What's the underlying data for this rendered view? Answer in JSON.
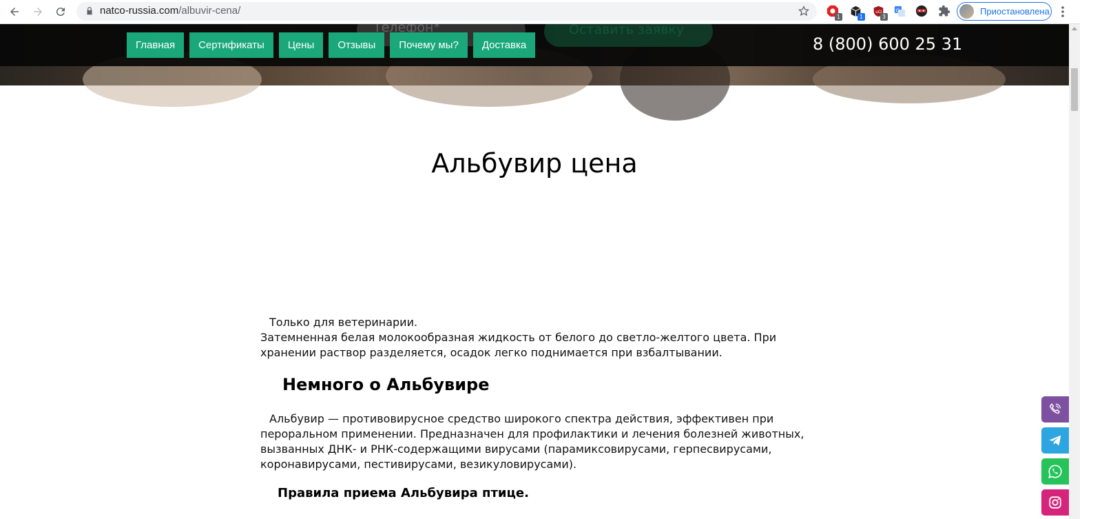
{
  "browser": {
    "url_domain": "natco-russia.com",
    "url_path": "/albuvir-cena/",
    "extensions": [
      {
        "name": "adblock-extension",
        "badge": "1",
        "color": "#e02424"
      },
      {
        "name": "cube-extension",
        "badge": "1",
        "color": "#202124"
      },
      {
        "name": "ublock-extension",
        "badge": "3",
        "color": "#a3181d"
      },
      {
        "name": "translate-extension",
        "badge": "",
        "color": "#4285f4"
      },
      {
        "name": "ninja-extension",
        "badge": "",
        "color": "#d93025"
      },
      {
        "name": "puzzle-extension",
        "badge": "",
        "color": "#5f6368"
      }
    ],
    "profile_label": "Приостановлена"
  },
  "header": {
    "ghost_input_placeholder": "Телефон*",
    "ghost_button_label": "Оставить заявку",
    "nav": [
      {
        "label": "Главная"
      },
      {
        "label": "Сертификаты"
      },
      {
        "label": "Цены"
      },
      {
        "label": "Отзывы"
      },
      {
        "label": "Почему мы?"
      },
      {
        "label": "Доставка"
      }
    ],
    "phone": "8 (800) 600 25 31",
    "accent_color": "#1aa87a"
  },
  "main": {
    "title": "Альбувир цена",
    "intro_line1": "Только для ветеринарии.",
    "intro_line2": "Затемненная белая молокообразная жидкость от белого до светло-желтого цвета. При хранении раствор разделяется, осадок легко поднимается при взбалтывании.",
    "section_heading": "Немного о Альбувире",
    "section_text": "Альбувир — противовирусное средство широкого спектра действия, эффективен при пероральном применении. Предназначен для профилактики и лечения болезней животных, вызванных ДНК- и РНК-содержащими вирусами (парамиксовирусами, герпесвирусами, коронавирусами, пестивирусами, везикуловирусами).",
    "subheading": "Правила приема Альбувира птице."
  },
  "social_buttons": [
    {
      "name": "viber-button",
      "color": "#7d51a0"
    },
    {
      "name": "telegram-button",
      "color": "#2ca5e0"
    },
    {
      "name": "whatsapp-button",
      "color": "#25c35a"
    },
    {
      "name": "instagram-button",
      "color": "#d6247a"
    }
  ]
}
